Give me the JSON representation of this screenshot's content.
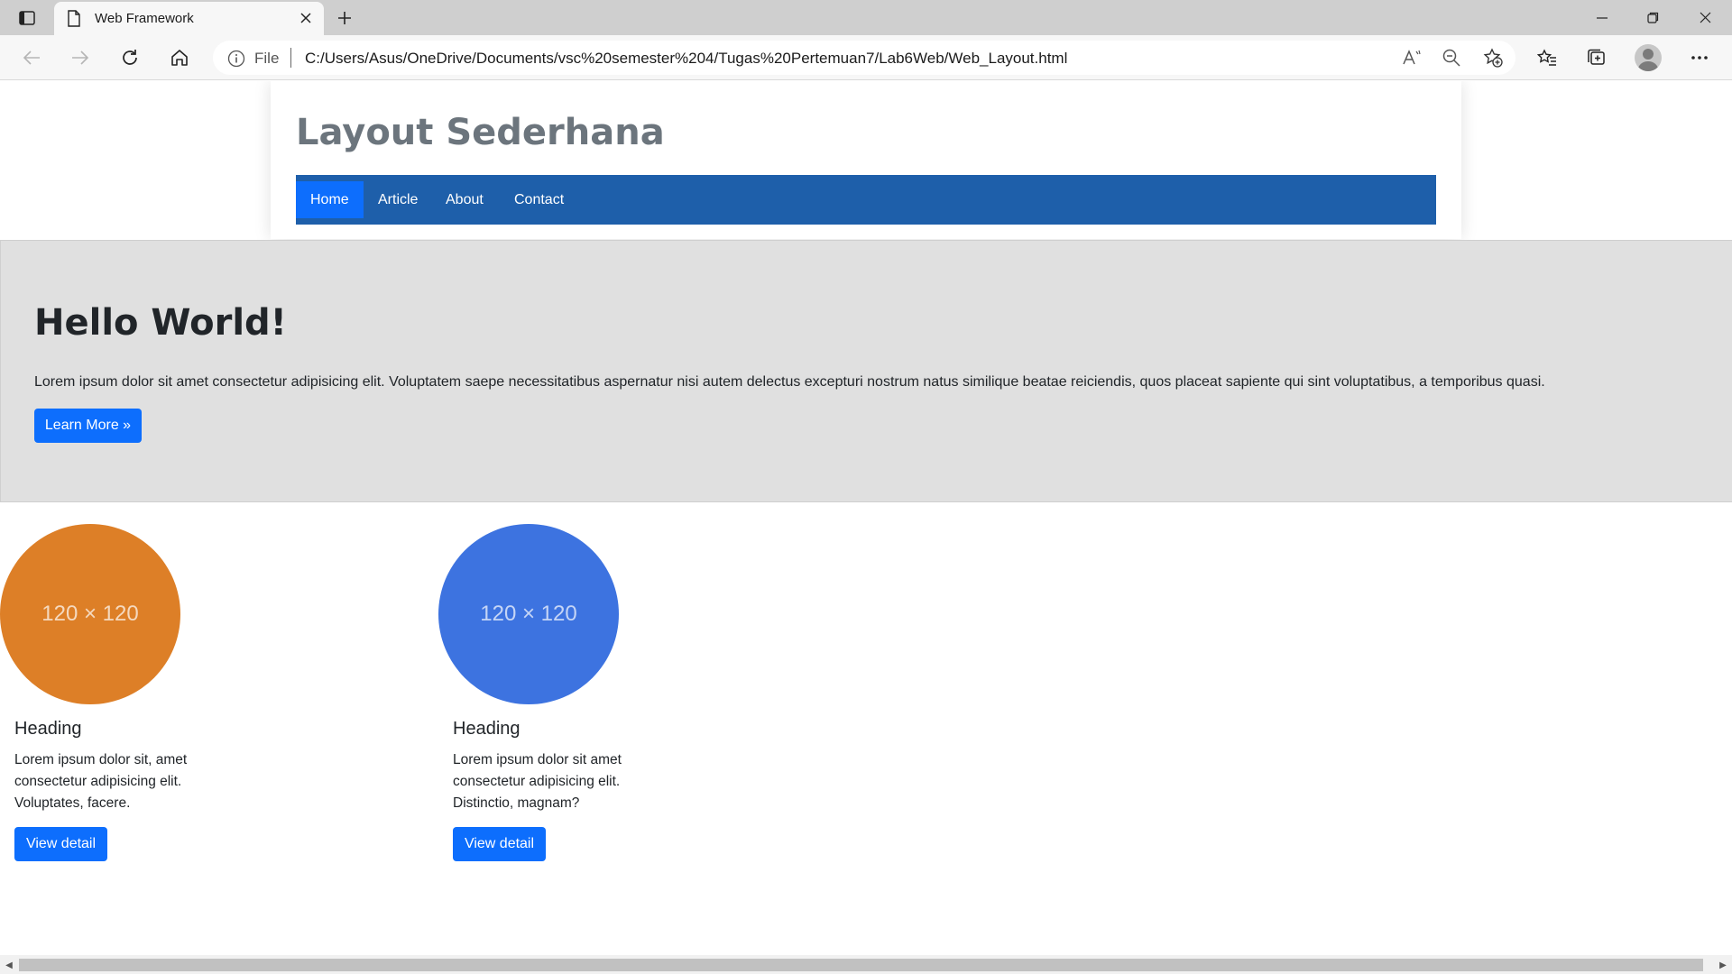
{
  "browser": {
    "tab_title": "Web Framework",
    "address": {
      "scheme_label": "File",
      "url": "C:/Users/Asus/OneDrive/Documents/vsc%20semester%204/Tugas%20Pertemuan7/Lab6Web/Web_Layout.html"
    },
    "icons": [
      "tab-actions-icon",
      "page-icon",
      "close-icon",
      "plus-icon",
      "minimize-icon",
      "restore-icon",
      "window-close-icon",
      "back-icon",
      "forward-icon",
      "refresh-icon",
      "home-icon",
      "info-icon",
      "read-aloud-icon",
      "zoom-out-icon",
      "add-favorite-icon",
      "favorites-icon",
      "collections-icon",
      "profile-icon",
      "more-icon"
    ]
  },
  "page": {
    "site_title": "Layout Sederhana",
    "nav": [
      {
        "label": "Home",
        "active": true
      },
      {
        "label": "Article",
        "active": false
      },
      {
        "label": "About",
        "active": false
      },
      {
        "label": "Contact",
        "active": false
      }
    ],
    "hero": {
      "heading": "Hello World!",
      "text": "Lorem ipsum dolor sit amet consectetur adipisicing elit. Voluptatem saepe necessitatibus aspernatur nisi autem delectus excepturi nostrum natus similique beatae reiciendis, quos placeat sapiente qui sint voluptatibus, a temporibus quasi.",
      "button": "Learn More »"
    },
    "cards": [
      {
        "image_label": "120 × 120",
        "color": "#dd7f27",
        "heading": "Heading",
        "text": "Lorem ipsum dolor sit, amet consectetur adipisicing elit. Voluptates, facere.",
        "button": "View detail"
      },
      {
        "image_label": "120 × 120",
        "color": "#3d73e0",
        "heading": "Heading",
        "text": "Lorem ipsum dolor sit amet consectetur adipisicing elit. Distinctio, magnam?",
        "button": "View detail"
      }
    ]
  },
  "colors": {
    "navbar": "#1e5faa",
    "primary": "#0d6efd",
    "hero_bg": "#e0e0e0"
  }
}
